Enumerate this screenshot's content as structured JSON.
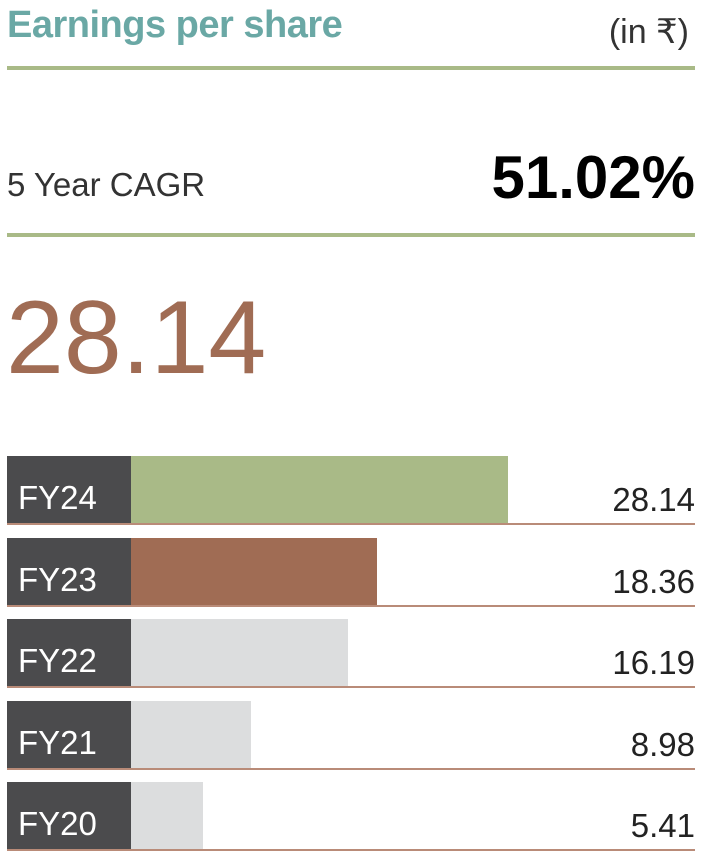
{
  "header": {
    "title": "Earnings per share",
    "unit": "(in ₹)"
  },
  "cagr": {
    "label": "5 Year CAGR",
    "value": "51.02%"
  },
  "highlight": {
    "value": "28.14"
  },
  "colors": {
    "title": "#6aa8a5",
    "rule": "#a9ba87",
    "highlight_number": "#a06c54",
    "label_box": "#4b4b4d",
    "baseline": "#b98b78",
    "bar_latest": "#a9ba87",
    "bar_previous": "#a06c54",
    "bar_other": "#dcddde"
  },
  "chart_data": {
    "type": "bar",
    "orientation": "horizontal",
    "categories": [
      "FY24",
      "FY23",
      "FY22",
      "FY21",
      "FY20"
    ],
    "values": [
      28.14,
      18.36,
      16.19,
      8.98,
      5.41
    ],
    "value_labels": [
      "28.14",
      "18.36",
      "16.19",
      "8.98",
      "5.41"
    ],
    "xlim": [
      0,
      28.14
    ],
    "title": "Earnings per share",
    "grid": false
  }
}
